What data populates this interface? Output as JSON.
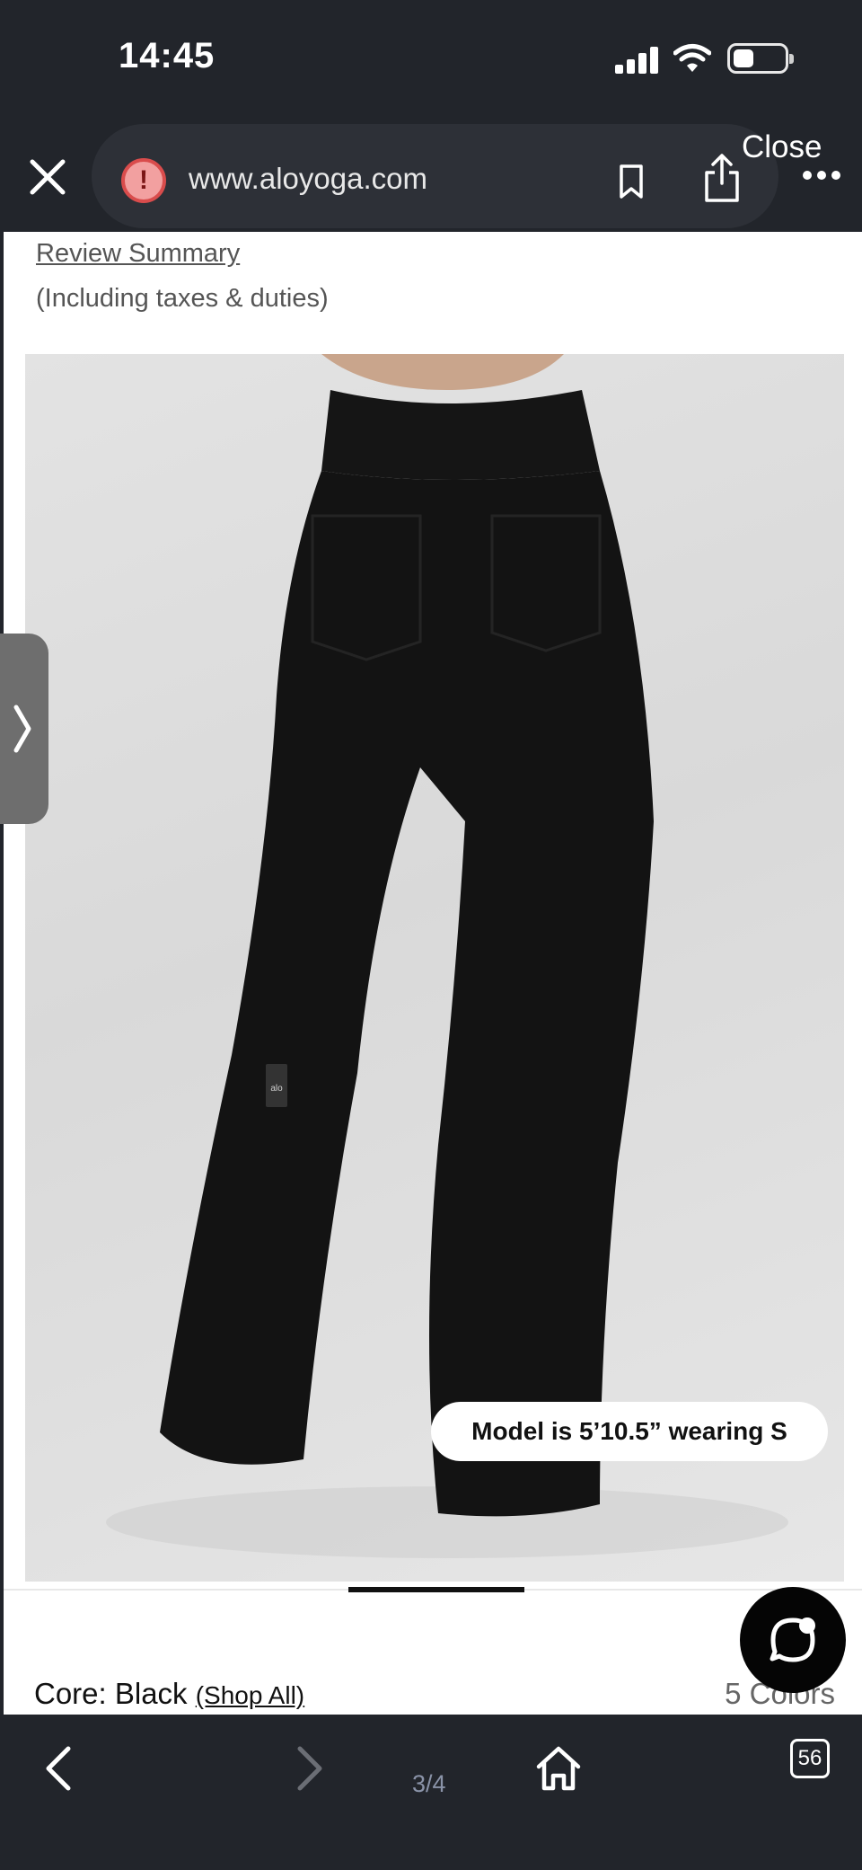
{
  "status_bar": {
    "time": "14:45",
    "signal_icon": "cellular-signal-icon",
    "wifi_icon": "wifi-icon",
    "battery_icon": "battery-icon"
  },
  "browser": {
    "url": "www.aloyoga.com",
    "close_label": "Close",
    "warning_icon": "!",
    "page_indicator": "3/4",
    "tab_count": "56"
  },
  "product": {
    "review_link": "Review Summary",
    "taxes_note": "(Including taxes & duties)",
    "model_info": "Model is 5’10.5” wearing S",
    "color_prefix": "Core: Black",
    "shop_all": "(Shop All)",
    "color_count": "5 Colors",
    "logo_text": "alo"
  },
  "colors": {
    "toolbar_bg": "#22252b",
    "url_pill_bg": "#2d3037",
    "warning_red": "#d94c4c",
    "page_bg": "#ffffff",
    "image_bg": "#e0e0e0",
    "garment": "#141414"
  }
}
